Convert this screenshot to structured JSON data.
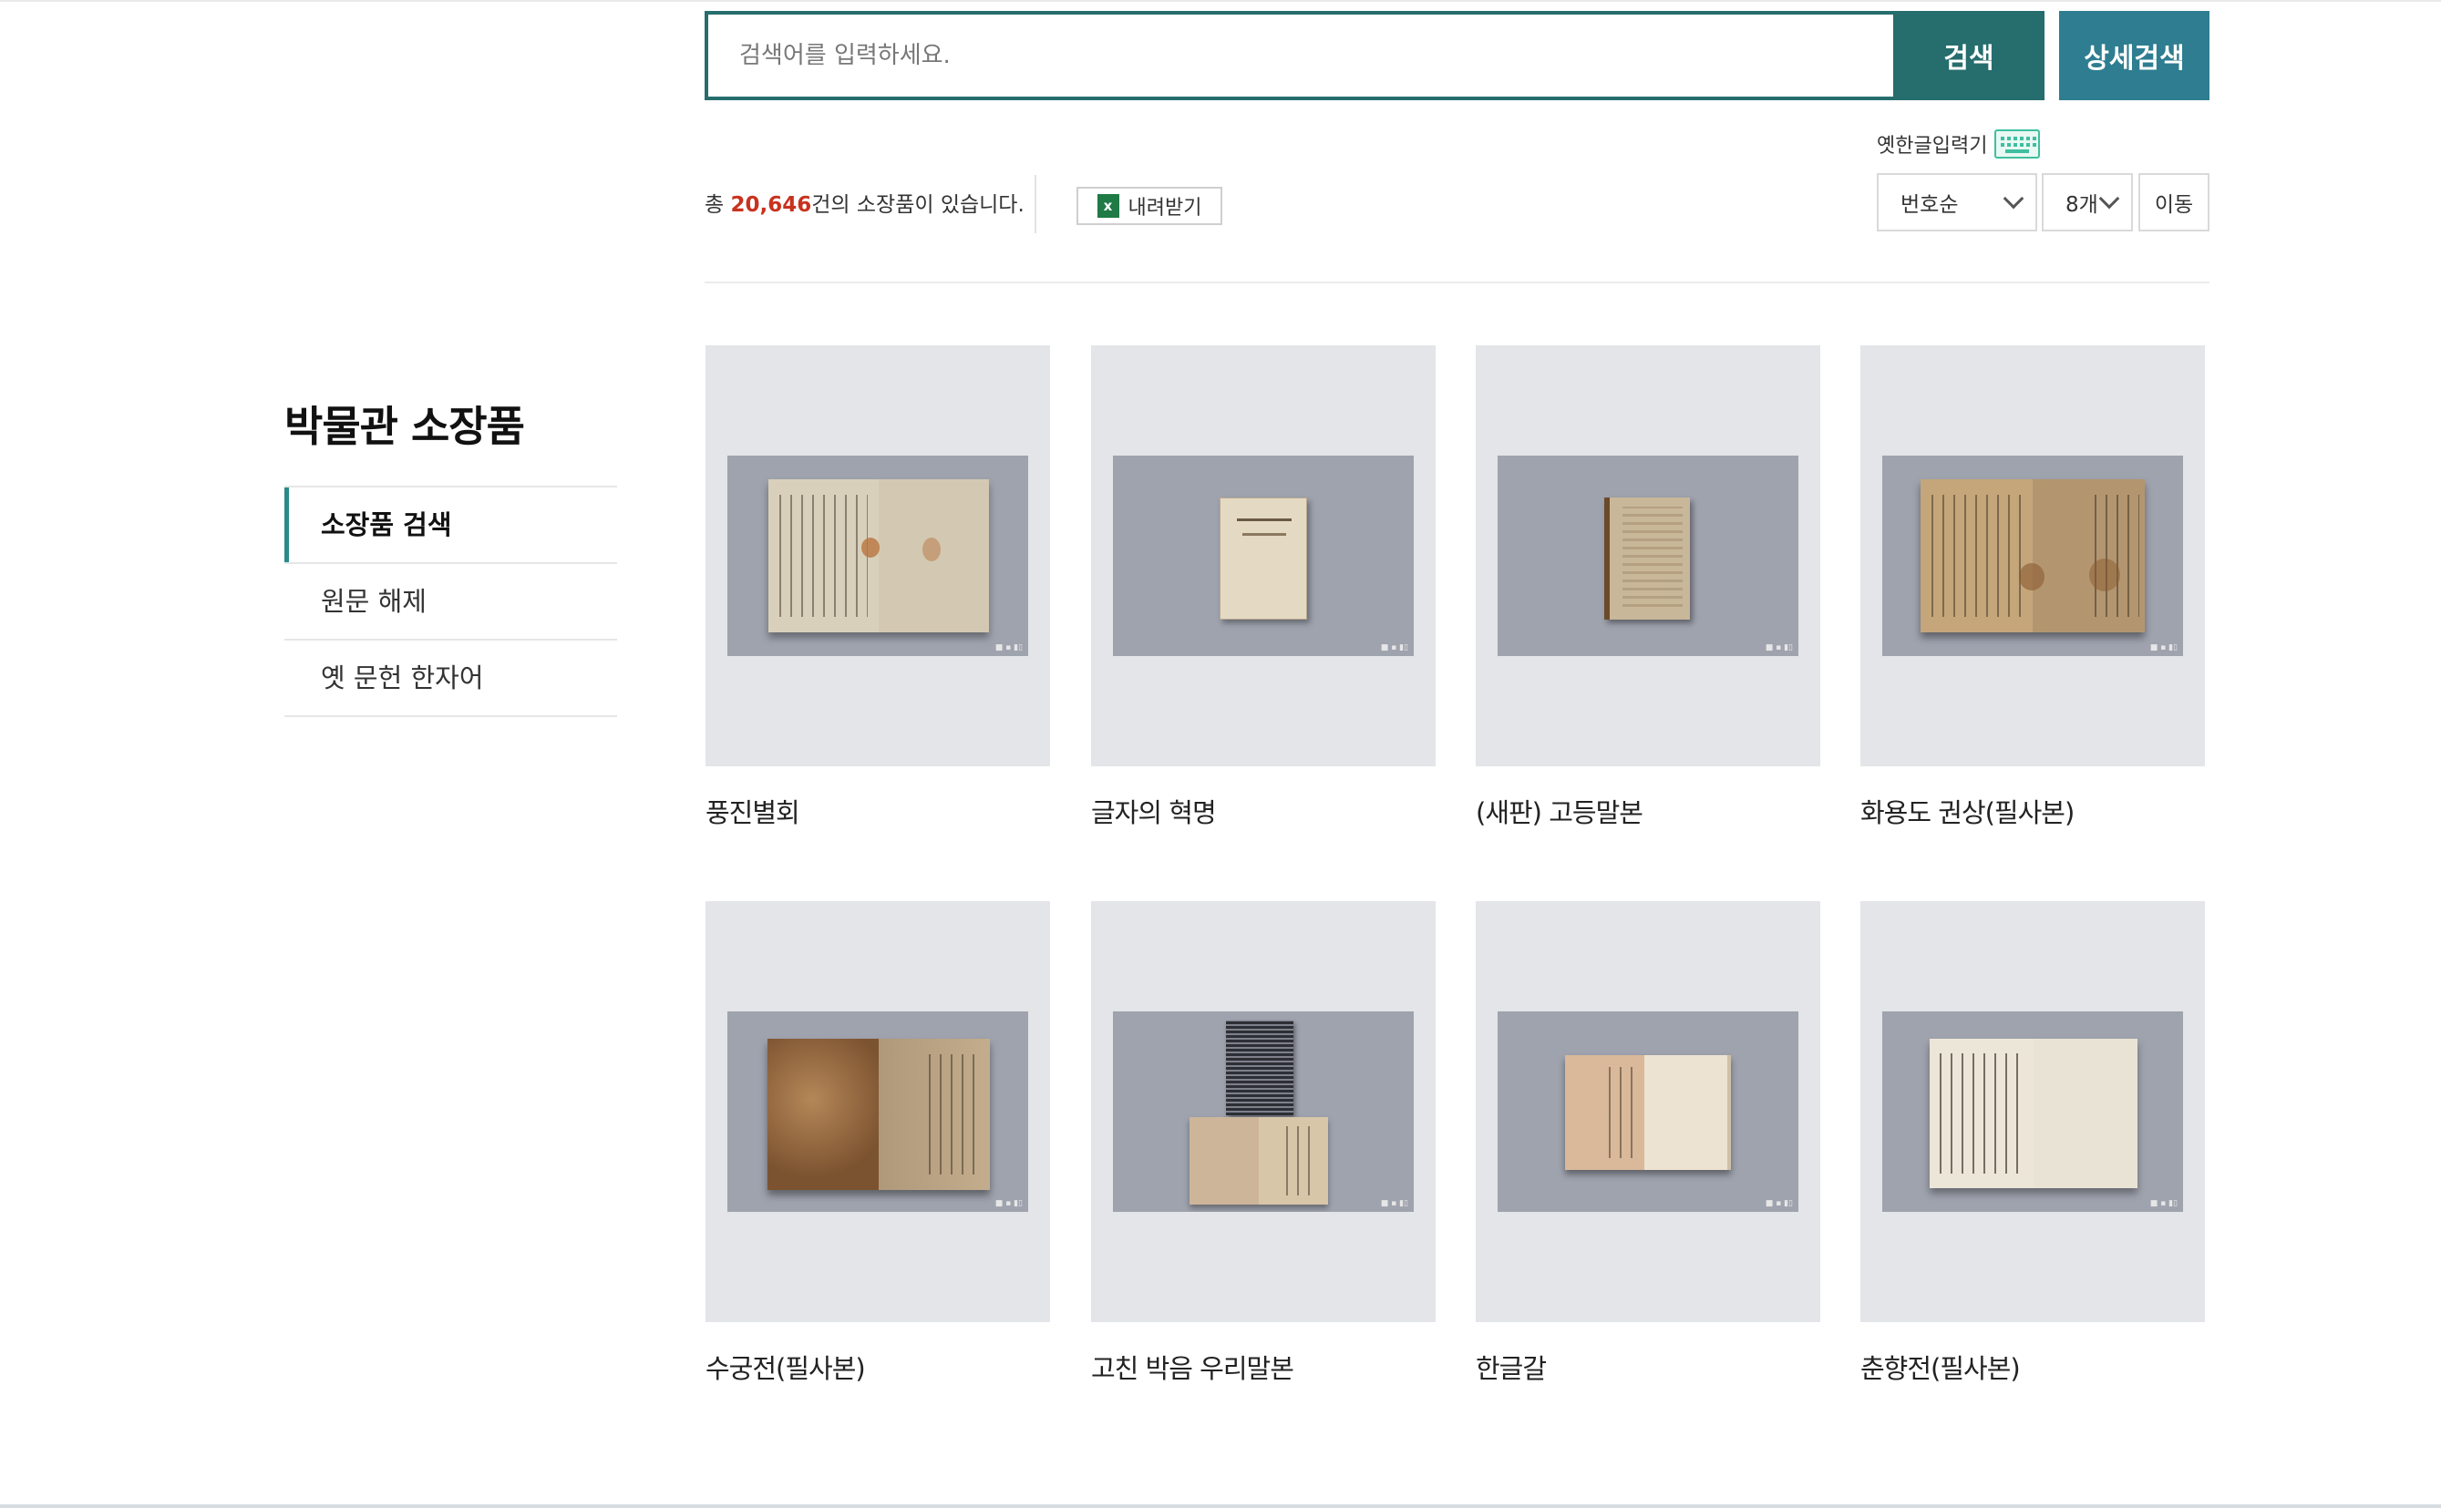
{
  "sidebar": {
    "title": "박물관 소장품",
    "items": [
      {
        "label": "소장품 검색",
        "active": true
      },
      {
        "label": "원문 해제",
        "active": false
      },
      {
        "label": "옛 문헌 한자어",
        "active": false
      }
    ]
  },
  "search": {
    "placeholder": "검색어를 입력하세요.",
    "button_label": "검색",
    "advanced_label": "상세검색",
    "old_hangul_label": "옛한글입력기"
  },
  "results": {
    "prefix": "총 ",
    "count": "20,646",
    "suffix": "건의 소장품이 있습니다.",
    "download_label": "내려받기",
    "download_icon_letter": "x"
  },
  "controls": {
    "sort_value": "번호순",
    "per_page_value": "8개",
    "go_label": "이동"
  },
  "items": [
    {
      "title": "풍진별회",
      "icon": "open-book-manuscript"
    },
    {
      "title": "글자의 혁명",
      "icon": "closed-booklet"
    },
    {
      "title": "(새판) 고등말본",
      "icon": "closed-book"
    },
    {
      "title": "화용도 권상(필사본)",
      "icon": "open-book-manuscript"
    },
    {
      "title": "수궁전(필사본)",
      "icon": "open-book-manuscript"
    },
    {
      "title": "고친 박음 우리말본",
      "icon": "two-books"
    },
    {
      "title": "한글갈",
      "icon": "open-book"
    },
    {
      "title": "춘향전(필사본)",
      "icon": "open-book-manuscript"
    }
  ],
  "colors": {
    "search_border": "#266d6d",
    "search_button": "#266d6d",
    "advanced_button": "#2e7d90",
    "count_highlight": "#c8321e",
    "sidebar_accent": "#2a8a8a"
  }
}
